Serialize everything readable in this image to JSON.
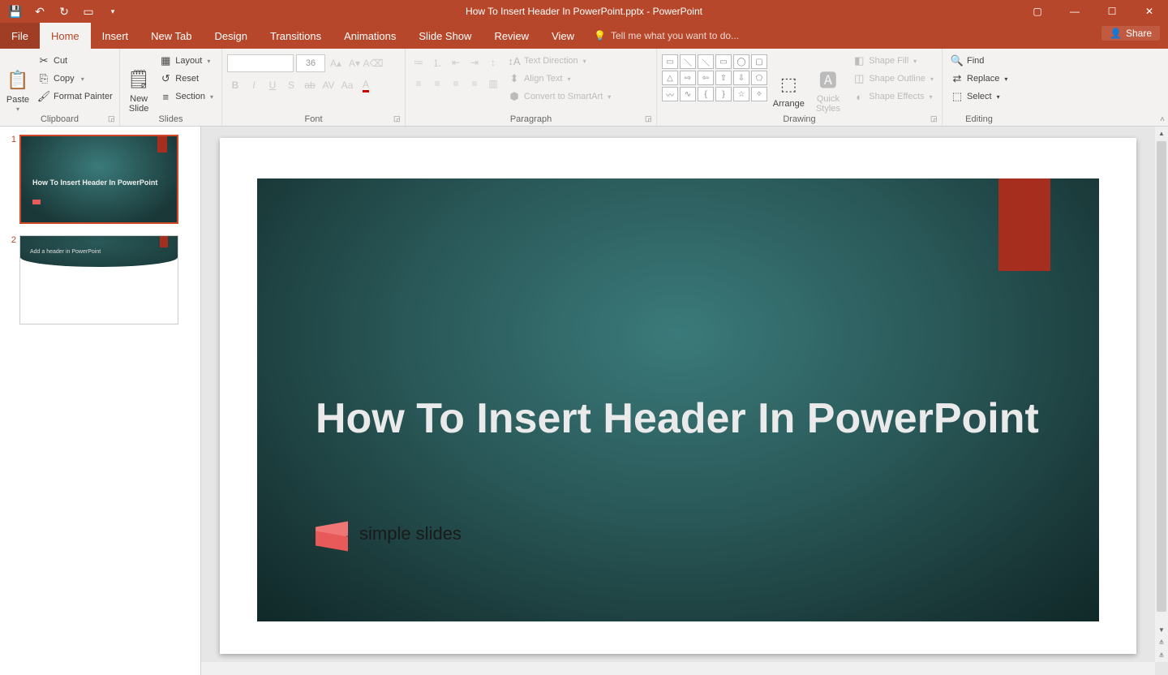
{
  "titlebar": {
    "title": "How To Insert Header In PowerPoint.pptx - PowerPoint"
  },
  "tabs": {
    "file": "File",
    "home": "Home",
    "insert": "Insert",
    "newtab": "New Tab",
    "design": "Design",
    "transitions": "Transitions",
    "animations": "Animations",
    "slideshow": "Slide Show",
    "review": "Review",
    "view": "View",
    "tellme": "Tell me what you want to do...",
    "share": "Share"
  },
  "ribbon": {
    "clipboard": {
      "label": "Clipboard",
      "paste": "Paste",
      "cut": "Cut",
      "copy": "Copy",
      "fp": "Format Painter"
    },
    "slides": {
      "label": "Slides",
      "new": "New\nSlide",
      "layout": "Layout",
      "reset": "Reset",
      "section": "Section"
    },
    "font": {
      "label": "Font",
      "size": "36"
    },
    "paragraph": {
      "label": "Paragraph",
      "textdir": "Text Direction",
      "align": "Align Text",
      "smart": "Convert to SmartArt"
    },
    "drawing": {
      "label": "Drawing",
      "arrange": "Arrange",
      "quick": "Quick\nStyles",
      "sfill": "Shape Fill",
      "soutline": "Shape Outline",
      "seffects": "Shape Effects"
    },
    "editing": {
      "label": "Editing",
      "find": "Find",
      "replace": "Replace",
      "select": "Select"
    }
  },
  "thumbs": [
    {
      "num": "1",
      "title": "How To Insert Header In PowerPoint"
    },
    {
      "num": "2",
      "title": "Add a header in PowerPoint"
    }
  ],
  "slide": {
    "title": "How To Insert Header In PowerPoint",
    "logo_text": "simple slides"
  }
}
